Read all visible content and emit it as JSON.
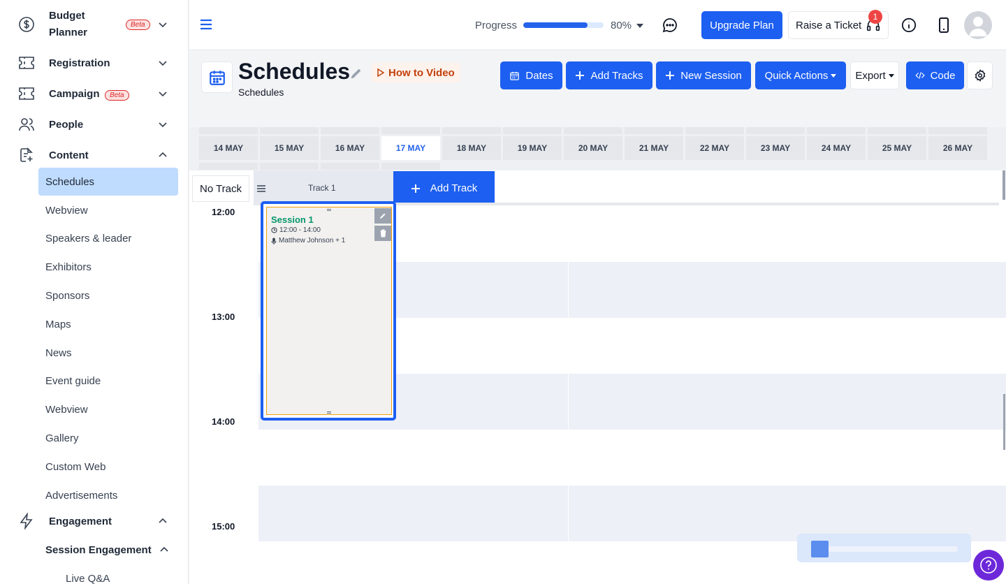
{
  "sidebar": {
    "budget_label": "Budget Planner",
    "budget_badge": "Beta",
    "registration": "Registration",
    "campaign": "Campaign",
    "campaign_badge": "Beta",
    "people": "People",
    "content": "Content",
    "content_items": [
      "Schedules",
      "Webview",
      "Speakers & leader",
      "Exhibitors",
      "Sponsors",
      "Maps",
      "News",
      "Event guide",
      "Webview",
      "Gallery",
      "Custom Web",
      "Advertisements"
    ],
    "engagement": "Engagement",
    "session_engagement": "Session Engagement",
    "live_qa": "Live Q&A"
  },
  "topbar": {
    "progress_label": "Progress",
    "progress_value": "80%",
    "progress_fraction": 0.8,
    "upgrade_label": "Upgrade Plan",
    "ticket_label": "Raise a Ticket",
    "ticket_count": "1"
  },
  "header": {
    "title": "Schedules",
    "subtitle": "Schedules",
    "how_to_video": "How to Video",
    "buttons": {
      "dates": "Dates",
      "add_tracks": "Add Tracks",
      "new_session": "New Session",
      "quick_actions": "Quick Actions",
      "export": "Export",
      "code": "Code"
    }
  },
  "calendar": {
    "dates": [
      "14 MAY",
      "15 MAY",
      "16 MAY",
      "17 MAY",
      "18 MAY",
      "19 MAY",
      "20 MAY",
      "21 MAY",
      "22 MAY",
      "23 MAY",
      "24 MAY",
      "25 MAY",
      "26 MAY"
    ],
    "active_date": "17 MAY",
    "no_track": "No Track",
    "track_name": "Track 1",
    "add_track": "Add Track",
    "times": [
      "12:00",
      "13:00",
      "14:00",
      "15:00"
    ],
    "session": {
      "title": "Session 1",
      "time": "12:00 - 14:00",
      "speakers": "Matthew Johnson + 1"
    }
  },
  "colors": {
    "primary": "#1d5ff0",
    "active_nav": "#bfdbfe",
    "session_title": "#059669",
    "help": "#6d28d9"
  }
}
